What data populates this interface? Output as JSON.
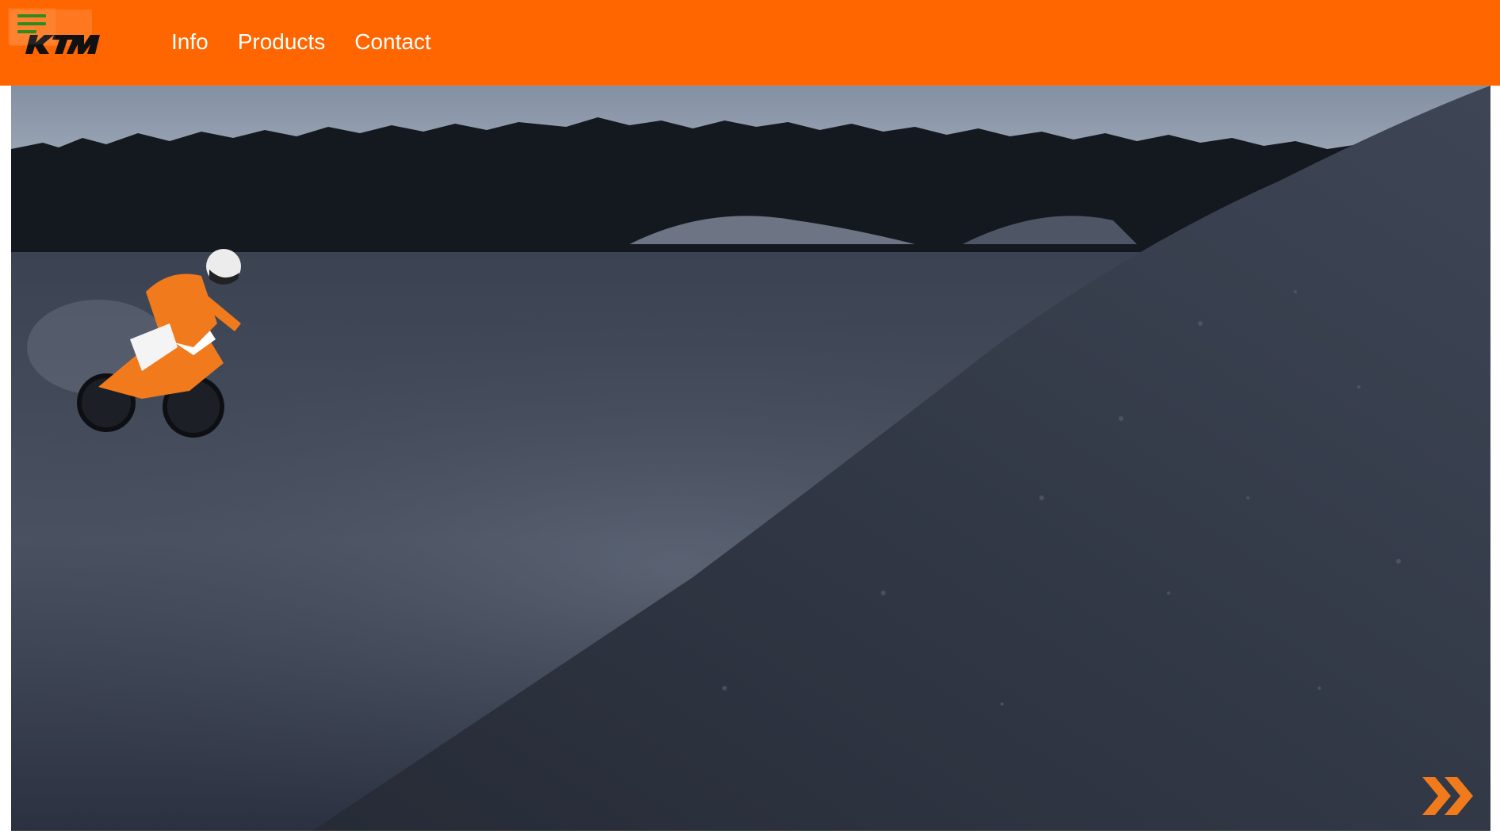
{
  "brand": {
    "logo_text": "KTM",
    "color": "#ff6600"
  },
  "nav": {
    "items": [
      {
        "label": "Info"
      },
      {
        "label": "Products"
      },
      {
        "label": "Contact"
      }
    ]
  },
  "hero": {
    "image_subject": "motocross-rider-on-dirt-track",
    "next_icon": "double-chevron-right-icon"
  },
  "colors": {
    "accent": "#ff6600",
    "menu_icon": "#2f8a1f",
    "nav_text": "#ffffff"
  }
}
